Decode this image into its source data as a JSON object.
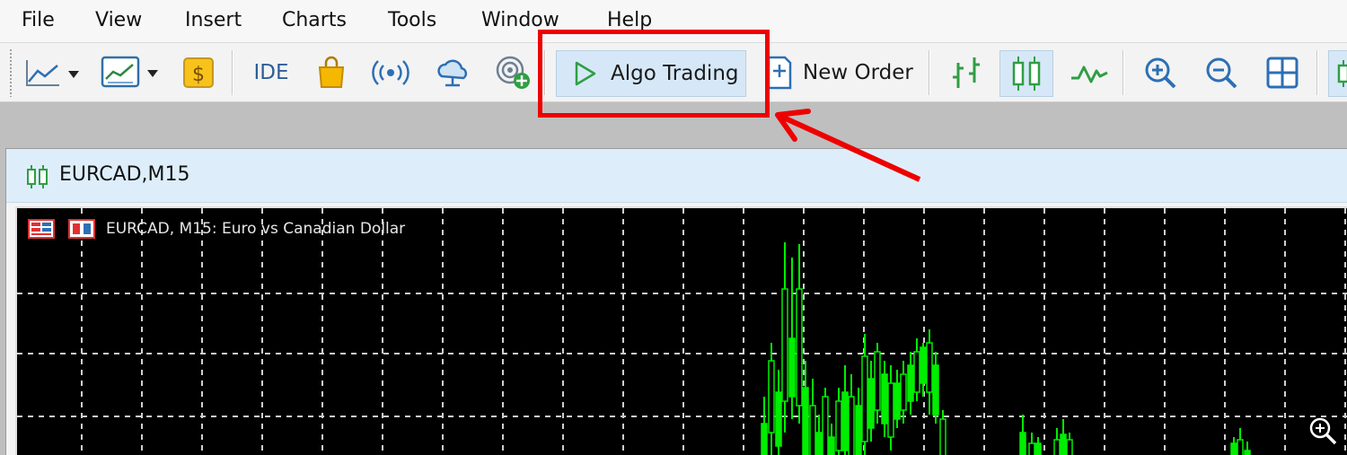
{
  "menu": {
    "items": [
      "File",
      "View",
      "Insert",
      "Charts",
      "Tools",
      "Window",
      "Help"
    ]
  },
  "toolbar": {
    "ide_label": "IDE",
    "algo_trading_label": "Algo Trading",
    "new_order_label": "New Order"
  },
  "chart": {
    "tab_title": "EURCAD,M15",
    "caption": "EURCAD, M15:  Euro vs Canadian Dollar"
  },
  "colors": {
    "accent_red": "#ee0000",
    "candle_green": "#00ee00",
    "button_pressed": "#d6e8f7",
    "chart_background": "#000000"
  },
  "icons": [
    "line-chart-icon",
    "template-icon",
    "dollar-icon",
    "market-bag-icon",
    "signals-icon",
    "cloud-icon",
    "add-signal-icon",
    "play-icon",
    "new-order-icon",
    "bar-chart-icon",
    "candlestick-icon",
    "line-chart-icon",
    "zoom-in-icon",
    "zoom-out-icon",
    "tile-windows-icon",
    "magnifier-icon"
  ]
}
